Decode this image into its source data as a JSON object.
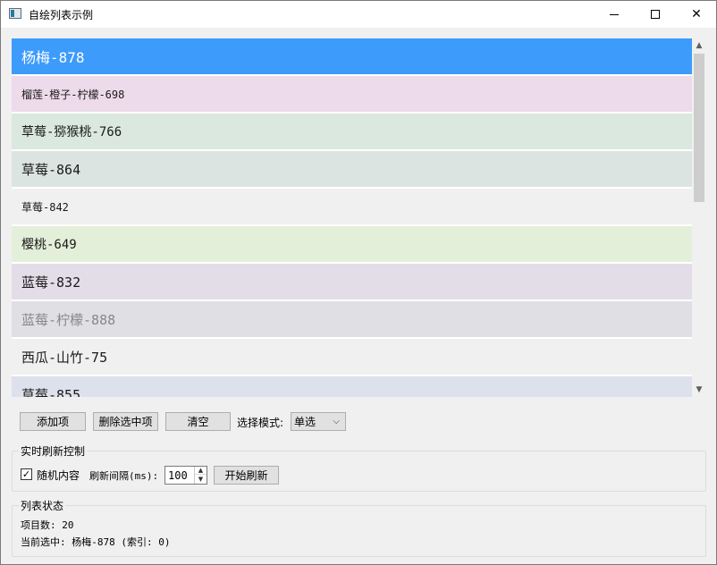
{
  "window": {
    "title": "自绘列表示例",
    "controls": {
      "minimize": "minimize",
      "maximize": "maximize",
      "close": "close"
    }
  },
  "list": {
    "items": [
      {
        "label": "杨梅-878",
        "bg": "#3d9bfb",
        "color": "#ffffff",
        "font_px": 16,
        "selected": true
      },
      {
        "label": "榴莲-橙子-柠檬-698",
        "bg": "#eddaeb",
        "color": "#1a1a1a",
        "font_px": 12
      },
      {
        "label": "草莓-猕猴桃-766",
        "bg": "#dae8df",
        "color": "#1a1a1a",
        "font_px": 14
      },
      {
        "label": "草莓-864",
        "bg": "#dce4e2",
        "color": "#1a1a1a",
        "font_px": 15
      },
      {
        "label": "草莓-842",
        "bg": "#f0f0f0",
        "color": "#1a1a1a",
        "font_px": 12
      },
      {
        "label": "樱桃-649",
        "bg": "#e4efda",
        "color": "#1a1a1a",
        "font_px": 14
      },
      {
        "label": "蓝莓-832",
        "bg": "#e3dde8",
        "color": "#1a1a1a",
        "font_px": 15
      },
      {
        "label": "蓝莓-柠檬-888",
        "bg": "#e0dfe3",
        "color": "#888888",
        "font_px": 15
      },
      {
        "label": "西瓜-山竹-75",
        "bg": "#f0f0f0",
        "color": "#1a1a1a",
        "font_px": 15
      },
      {
        "label": "草莓-855",
        "bg": "#dde1ec",
        "color": "#1a1a1a",
        "font_px": 15
      }
    ]
  },
  "toolbar": {
    "add_label": "添加项",
    "delete_label": "删除选中项",
    "clear_label": "清空",
    "mode_label": "选择模式:",
    "mode_value": "单选"
  },
  "refresh": {
    "group_title": "实时刷新控制",
    "random_label": "随机内容",
    "random_checked": true,
    "interval_label": "刷新间隔(ms):",
    "interval_value": "100",
    "start_label": "开始刷新"
  },
  "status": {
    "group_title": "列表状态",
    "count_text": "项目数: 20",
    "selection_text": "当前选中: 杨梅-878 (索引: 0)"
  },
  "colors": {
    "accent": "#3d9bfb",
    "window_bg": "#f0f0f0"
  }
}
